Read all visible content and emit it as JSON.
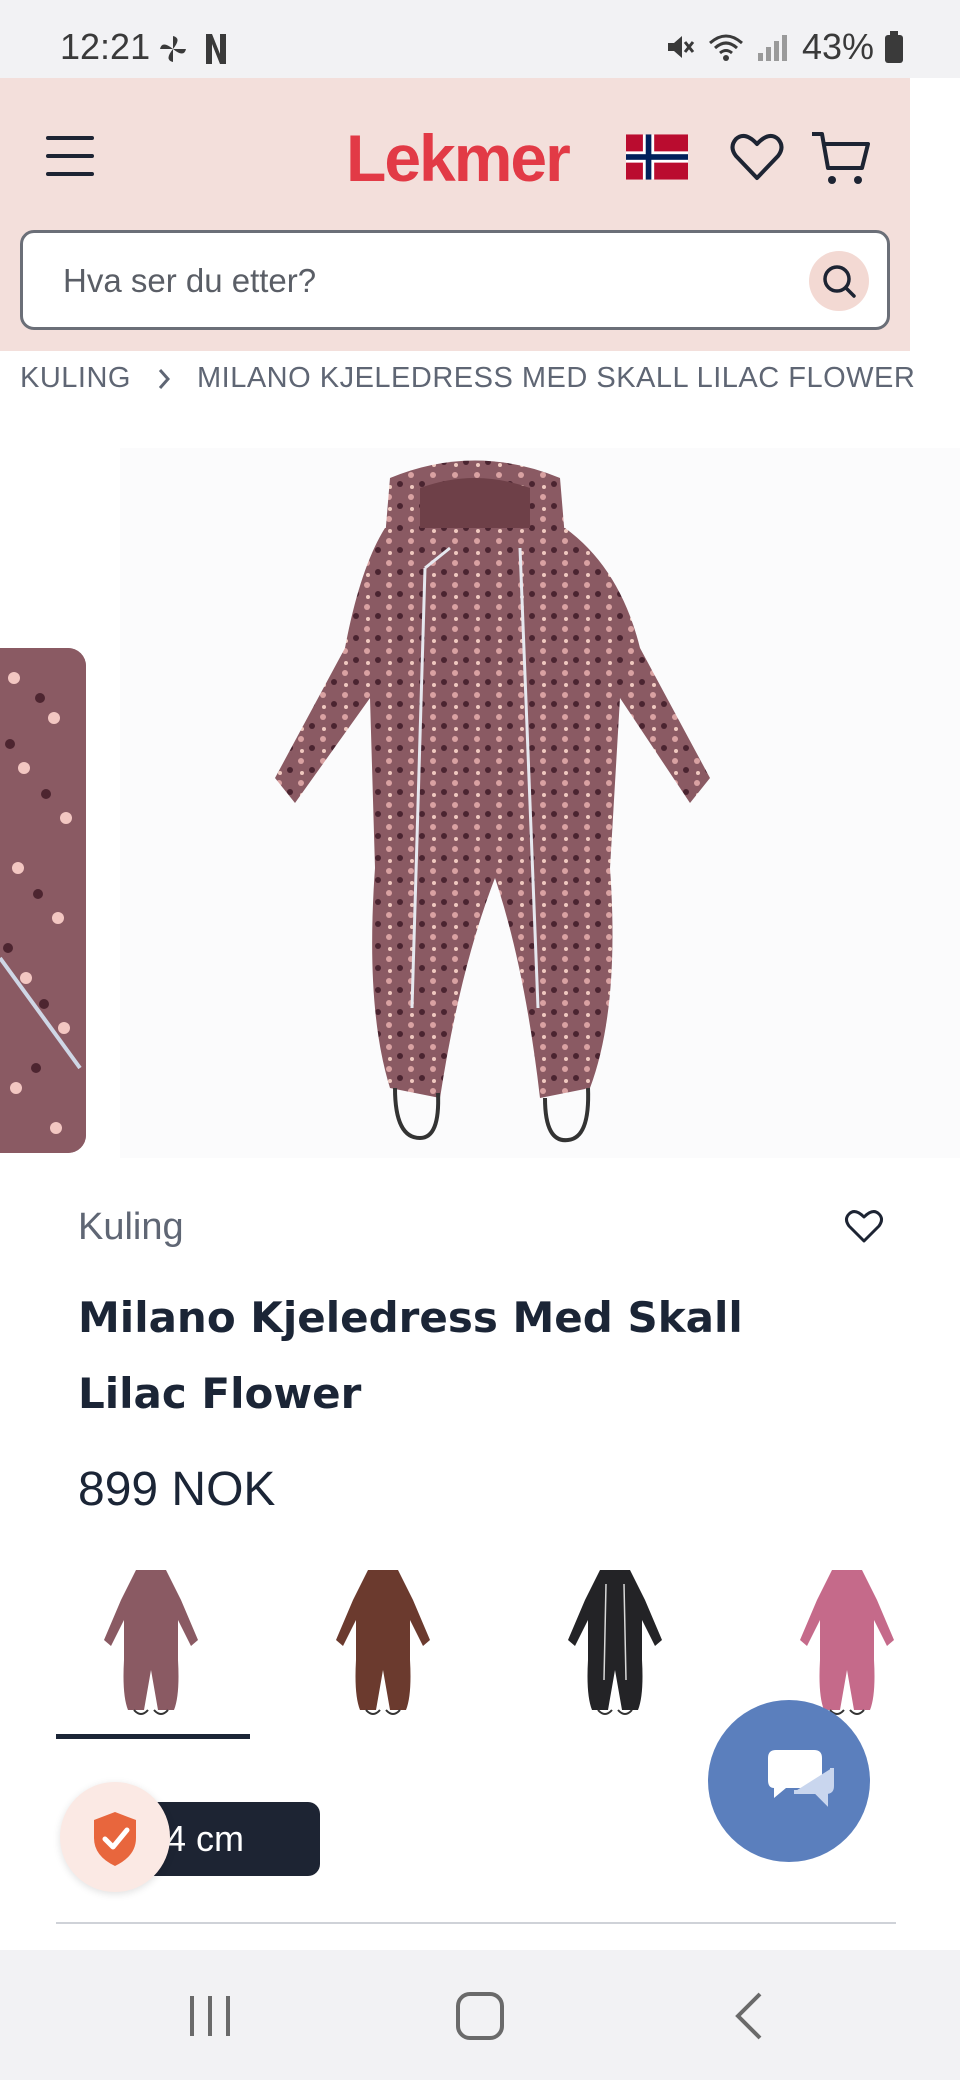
{
  "status_bar": {
    "time": "12:21",
    "battery": "43%"
  },
  "header": {
    "logo": "Lekmer",
    "search_placeholder": "Hva ser du etter?"
  },
  "breadcrumb": {
    "items": [
      "KULING",
      "MILANO KJELEDRESS MED SKALL LILAC FLOWER"
    ]
  },
  "product": {
    "brand": "Kuling",
    "title": "Milano Kjeledress Med Skall Lilac Flower",
    "price": "899 NOK",
    "variants": [
      {
        "color": "#8a5a63"
      },
      {
        "color": "#6b3a2e"
      },
      {
        "color": "#232326"
      },
      {
        "color": "#c56a8a"
      }
    ],
    "selected_size_label": "4 cm"
  },
  "colors": {
    "header_bg": "#f3dfdb",
    "brand_red": "#e23a46",
    "dark_text": "#1b2536",
    "chat_blue": "#5b7fbd"
  }
}
